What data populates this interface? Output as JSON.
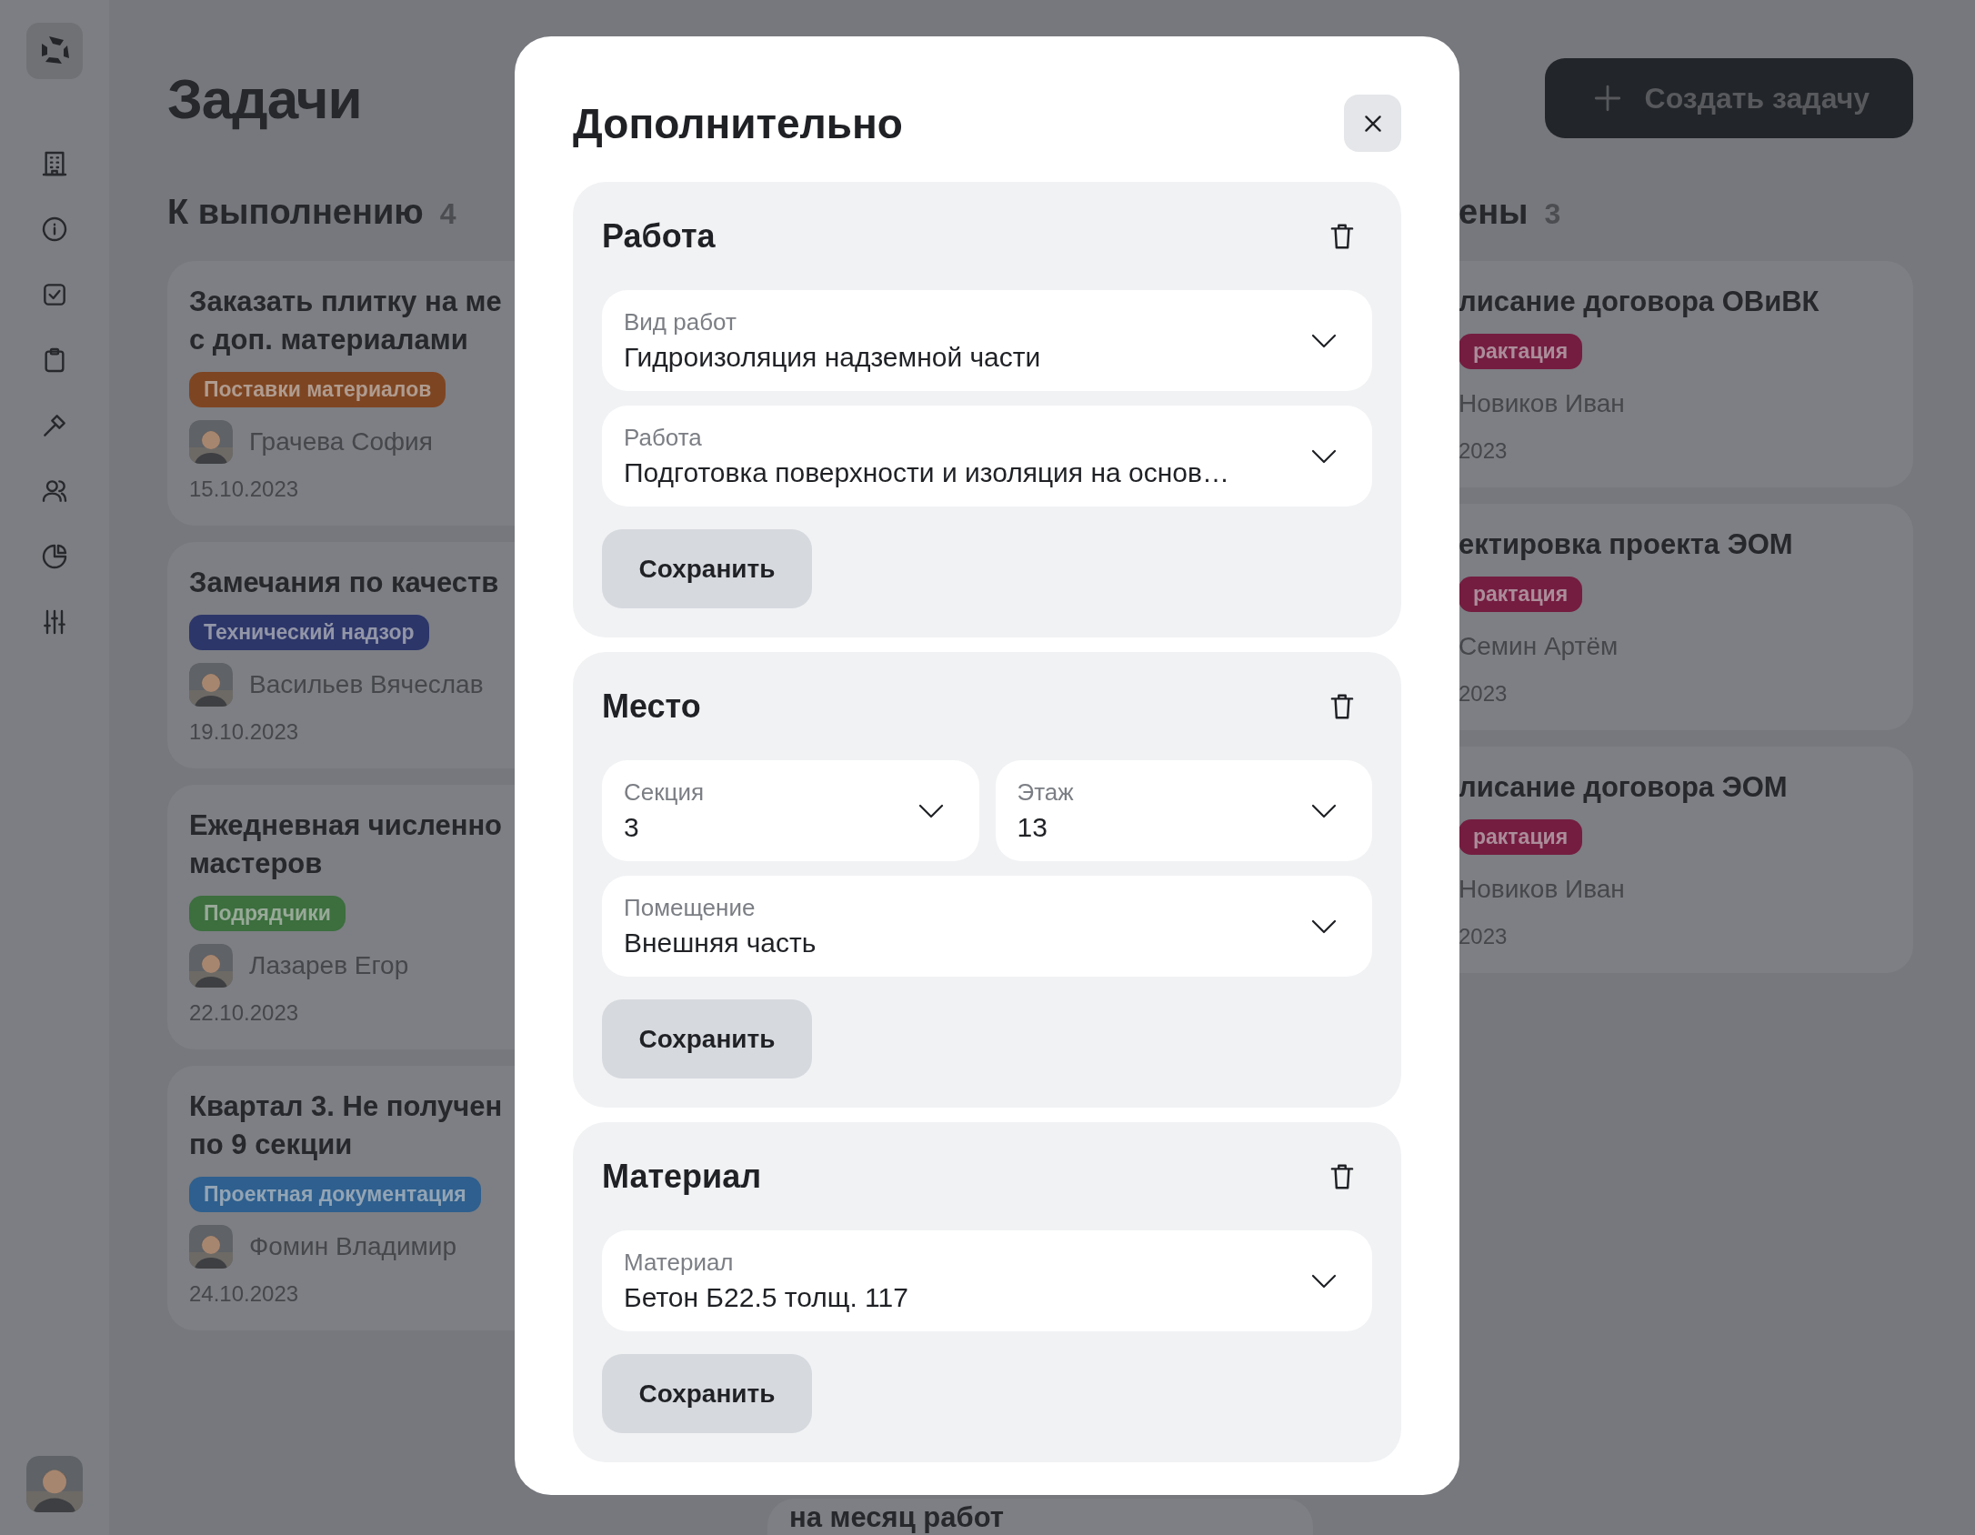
{
  "page": {
    "title": "Задачи",
    "create_button": "Создать задачу"
  },
  "columns": [
    {
      "kind": "list",
      "title": "К выполнению",
      "count": "4",
      "cards": [
        {
          "title": "Заказать плитку на ме",
          "title_2": "с доп. материалами",
          "tag": {
            "label": "Поставки материалов",
            "color": "#7e4522"
          },
          "assignee": "Грачева София",
          "date": "15.10.2023"
        },
        {
          "title": "Замечания по качеств",
          "tag": {
            "label": "Технический надзор",
            "color": "#2d3669"
          },
          "assignee": "Васильев Вячеслав",
          "date": "19.10.2023"
        },
        {
          "title": "Ежедневная численно",
          "title_2": "мастеров",
          "tag": {
            "label": "Подрядчики",
            "color": "#3c6e3e"
          },
          "assignee": "Лазарев Егор",
          "date": "22.10.2023"
        },
        {
          "title": "Квартал 3. Не получен",
          "title_2": "по 9 секции",
          "tag": {
            "label": "Проектная документация",
            "color": "#2e5f8e"
          },
          "assignee": "Фомин Владимир",
          "date": "24.10.2023"
        }
      ]
    },
    {
      "kind": "peek",
      "cards": [
        {
          "title": "на месяц работ"
        }
      ]
    },
    {
      "kind": "cut",
      "title": "ены",
      "count": "3",
      "cards": [
        {
          "title": "лисание договора ОВиВК",
          "tag": {
            "label": "рактация",
            "color": "#741d41"
          },
          "assignee": "Новиков Иван",
          "date": "2023"
        },
        {
          "title": "ектировка проекта ЭОМ",
          "tag": {
            "label": "рактация",
            "color": "#741d41"
          },
          "assignee": "Семин Артём",
          "date": "2023"
        },
        {
          "title": "лисание договора ЭОМ",
          "tag": {
            "label": "рактация",
            "color": "#741d41"
          },
          "assignee": "Новиков Иван",
          "date": "2023"
        }
      ]
    }
  ],
  "dialog": {
    "title": "Дополнительно",
    "sections": [
      {
        "title": "Работа",
        "rows": [
          [
            {
              "label": "Вид работ",
              "value": "Гидроизоляция надземной части"
            }
          ],
          [
            {
              "label": "Работа",
              "value": "Подготовка поверхности и изоляция на основ…"
            }
          ]
        ],
        "save_button": "Сохранить"
      },
      {
        "title": "Место",
        "rows": [
          [
            {
              "label": "Секция",
              "value": "3"
            },
            {
              "label": "Этаж",
              "value": "13"
            }
          ],
          [
            {
              "label": "Помещение",
              "value": "Внешняя часть"
            }
          ]
        ],
        "save_button": "Сохранить"
      },
      {
        "title": "Материал",
        "rows": [
          [
            {
              "label": "Материал",
              "value": "Бетон Б22.5 толщ. 117"
            }
          ]
        ],
        "save_button": "Сохранить"
      }
    ]
  }
}
